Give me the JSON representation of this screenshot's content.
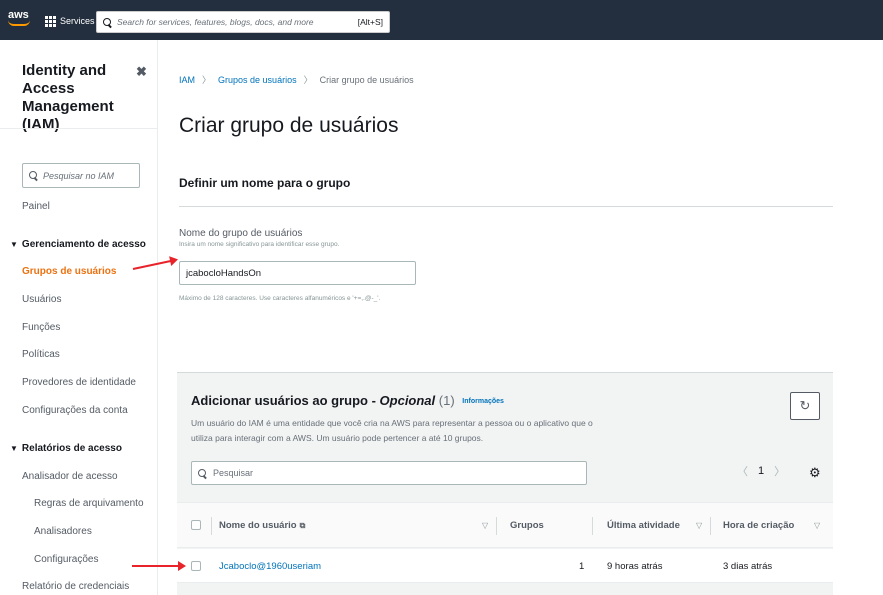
{
  "topbar": {
    "logo_text": "aws",
    "services_label": "Services",
    "search_placeholder": "Search for services, features, blogs, docs, and more",
    "search_shortcut": "[Alt+S]"
  },
  "sidebar": {
    "title": "Identity and Access Management (IAM)",
    "search_placeholder": "Pesquisar no IAM",
    "items": {
      "painel": "Painel",
      "gerenciamento": "Gerenciamento de acesso",
      "grupos": "Grupos de usuários",
      "usuarios": "Usuários",
      "funcoes": "Funções",
      "politicas": "Políticas",
      "provedores": "Provedores de identidade",
      "configuracoes_conta": "Configurações da conta",
      "relatorios": "Relatórios de acesso",
      "analisador": "Analisador de acesso",
      "regras": "Regras de arquivamento",
      "analisadores": "Analisadores",
      "configuracoes": "Configurações",
      "relatorio_credenciais": "Relatório de credenciais"
    }
  },
  "breadcrumb": {
    "iam": "IAM",
    "grupos": "Grupos de usuários",
    "current": "Criar grupo de usuários"
  },
  "page": {
    "title": "Criar grupo de usuários",
    "section_title": "Definir um nome para o grupo",
    "field_label": "Nome do grupo de usuários",
    "field_desc": "Insira um nome significativo para identificar esse grupo.",
    "field_value": "jcabocloHandsOn",
    "field_help": "Máximo de 128 caracteres. Use caracteres alfanuméricos e '+=,.@-_'."
  },
  "panel": {
    "title_main": "Adicionar usuários ao grupo - ",
    "title_optional": "Opcional",
    "count": "(1)",
    "info": "Informações",
    "description": "Um usuário do IAM é uma entidade que você cria na AWS para representar a pessoa ou o aplicativo que o utiliza para interagir com a AWS. Um usuário pode pertencer a até 10 grupos.",
    "search_placeholder": "Pesquisar",
    "page_number": "1",
    "columns": {
      "user": "Nome do usuário",
      "groups": "Grupos",
      "last_activity": "Última atividade",
      "created": "Hora de criação"
    },
    "rows": [
      {
        "user": "Jcaboclo@1960useriam",
        "groups": "1",
        "last_activity": "9 horas atrás",
        "created": "3 dias atrás"
      }
    ]
  },
  "icons": {
    "close": "close-icon",
    "refresh": "refresh-icon",
    "settings": "gear-icon",
    "external": "external-link-icon"
  },
  "colors": {
    "topbar": "#232f3e",
    "accent_orange": "#ec7211",
    "link_blue": "#0073bb",
    "annotation_arrow": "#e8232a"
  }
}
